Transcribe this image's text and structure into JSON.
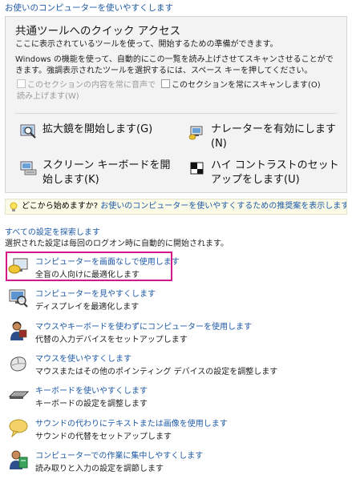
{
  "top_link": "お使いのコンピューターを使いやすくします",
  "quick_access": {
    "title": "共通ツールへのクイック アクセス",
    "desc1": "ここに表示されているツールを使って、開始するための準備ができます。",
    "desc2": "Windows の機能を使って、自動的にこの一覧を読み上げさせてスキャンさせることができます。強調表示されたツールを選択するには、スペース キーを押してください。",
    "check_read": "このセクションの内容を常に音声で読み上げます(W)",
    "check_scan": "このセクションを常にスキャンします(O)",
    "tools": {
      "magnifier": "拡大鏡を開始します(G)",
      "narrator": "ナレーターを有効にします (N)",
      "osk": "スクリーン キーボードを開始します(K)",
      "contrast": "ハイ コントラストのセットアップをします(U)"
    }
  },
  "tip": {
    "prefix": "どこから始めますか?",
    "link": "お使いのコンピューターを使いやすくするための推奨案を表示します(R)"
  },
  "explore": {
    "link": "すべての設定を探索します",
    "note": "選択された設定は毎回のログオン時に自動的に開始されます。"
  },
  "settings": [
    {
      "title": "コンピューターを画面なしで使用します",
      "desc": "全盲の人向けに最適化します",
      "icon": "monitor-speaker-icon"
    },
    {
      "title": "コンピューターを見やすくします",
      "desc": "ディスプレイを最適化します",
      "icon": "monitor-magnifier-icon"
    },
    {
      "title": "マウスやキーボードを使わずにコンピューターを使用します",
      "desc": "代替の入力デバイスをセットアップします",
      "icon": "user-headset-icon"
    },
    {
      "title": "マウスを使いやすくします",
      "desc": "マウスまたはその他のポインティング デバイスの設定を調整します",
      "icon": "mouse-icon"
    },
    {
      "title": "キーボードを使いやすくします",
      "desc": "キーボードの設定を調整します",
      "icon": "keyboard-icon"
    },
    {
      "title": "サウンドの代わりにテキストまたは画像を使用します",
      "desc": "サウンドの代替をセットアップします",
      "icon": "speech-bubble-icon"
    },
    {
      "title": "コンピューターでの作業に集中しやすくします",
      "desc": "読み取りと入力の設定を調節します",
      "icon": "user-book-icon"
    }
  ],
  "colors": {
    "link": "#1e5aa8",
    "highlight": "#d6178a",
    "panel_bg": "#f3f3f3",
    "tip_bg": "#fafae6"
  }
}
